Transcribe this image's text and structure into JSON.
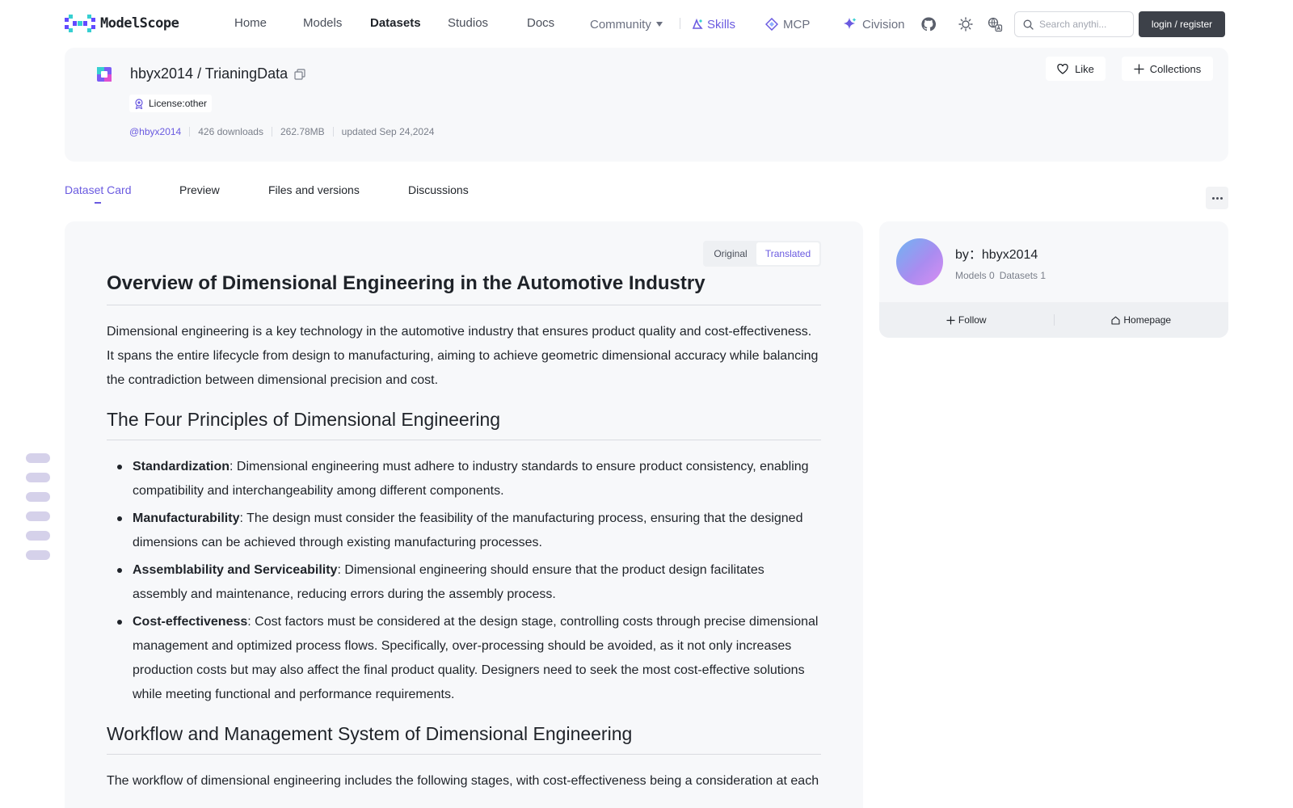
{
  "brand": {
    "name": "ModelScope",
    "accent": "#6a5ae0",
    "dark_button": "#3d4149"
  },
  "nav": {
    "home": "Home",
    "models": "Models",
    "datasets": "Datasets",
    "studios": "Studios",
    "docs": "Docs",
    "community": "Community",
    "skills": "Skills",
    "mcp": "MCP",
    "civision": "Civision"
  },
  "header_icons": [
    "github-icon",
    "sun-icon",
    "language-icon",
    "search-icon"
  ],
  "search": {
    "placeholder": "Search anythi..."
  },
  "auth": {
    "login_label": "login / register"
  },
  "repo": {
    "title": "hbyx2014 / TrianingData",
    "license": "License:other",
    "owner": "@hbyx2014",
    "downloads": "426 downloads",
    "size": "262.78MB",
    "updated": "updated Sep 24,2024",
    "like_label": "Like",
    "collections_label": "Collections"
  },
  "tabs": [
    {
      "label": "Dataset Card",
      "active": true
    },
    {
      "label": "Preview",
      "active": false
    },
    {
      "label": "Files and versions",
      "active": false
    },
    {
      "label": "Discussions",
      "active": false
    }
  ],
  "view_toggle": {
    "original": "Original",
    "translated": "Translated",
    "selected": "Translated"
  },
  "article": {
    "h1": "Overview of Dimensional Engineering in the Automotive Industry",
    "intro": "Dimensional engineering is a key technology in the automotive industry that ensures product quality and cost-effectiveness. It spans the entire lifecycle from design to manufacturing, aiming to achieve geometric dimensional accuracy while balancing the contradiction between dimensional precision and cost.",
    "h2_principles": "The Four Principles of Dimensional Engineering",
    "principles": [
      {
        "term": "Standardization",
        "text": ": Dimensional engineering must adhere to industry standards to ensure product consistency, enabling compatibility and interchangeability among different components."
      },
      {
        "term": "Manufacturability",
        "text": ": The design must consider the feasibility of the manufacturing process, ensuring that the designed dimensions can be achieved through existing manufacturing processes."
      },
      {
        "term": "Assemblability and Serviceability",
        "text": ": Dimensional engineering should ensure that the product design facilitates assembly and maintenance, reducing errors during the assembly process."
      },
      {
        "term": "Cost-effectiveness",
        "text": ": Cost factors must be considered at the design stage, controlling costs through precise dimensional management and optimized process flows. Specifically, over-processing should be avoided, as it not only increases production costs but may also affect the final product quality. Designers need to seek the most cost-effective solutions while meeting functional and performance requirements."
      }
    ],
    "h2_workflow": "Workflow and Management System of Dimensional Engineering",
    "workflow_intro": "The workflow of dimensional engineering includes the following stages, with cost-effectiveness being a consideration at each"
  },
  "author": {
    "name": "by：hbyx2014",
    "models": "Models 0",
    "datasets": "Datasets 1",
    "follow_label": "Follow",
    "homepage_label": "Homepage"
  }
}
